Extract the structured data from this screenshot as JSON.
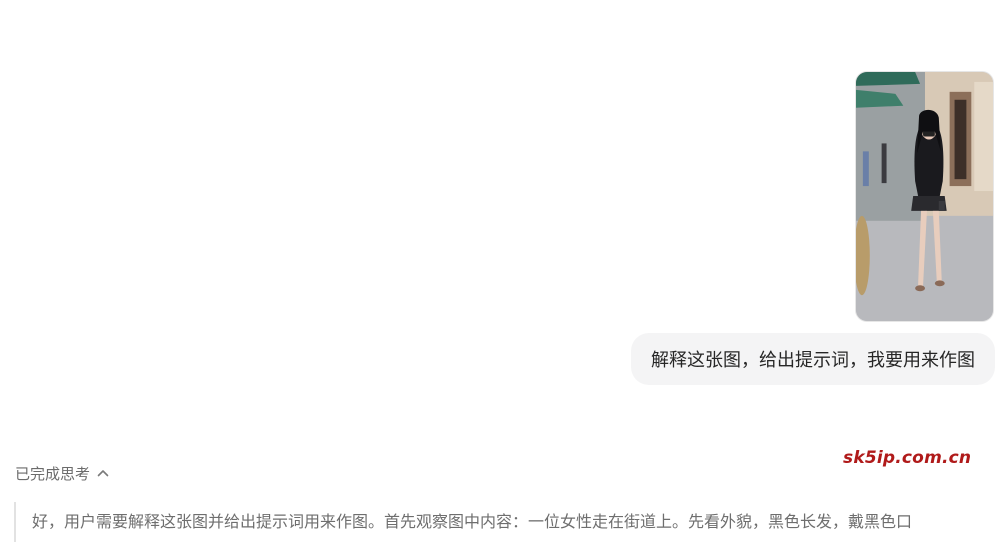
{
  "conversation": {
    "user_message": {
      "image": {
        "icon": "street-photo-thumbnail"
      },
      "text": "解释这张图，给出提示词，我要用来作图"
    },
    "assistant": {
      "thinking_toggle_label": "已完成思考",
      "thinking_toggle_icon": "chevron-up-icon",
      "reasoning_text": "好，用户需要解释这张图并给出提示词用来作图。首先观察图中内容：一位女性走在街道上。先看外貌，黑色长发，戴黑色口"
    }
  },
  "watermark": {
    "text": "sk5ip.com.cn",
    "color": "#b01a1a"
  },
  "colors": {
    "bubble_bg": "#f4f4f5",
    "muted_text": "#6b6b6b",
    "quote_border": "#e2e2e2"
  }
}
